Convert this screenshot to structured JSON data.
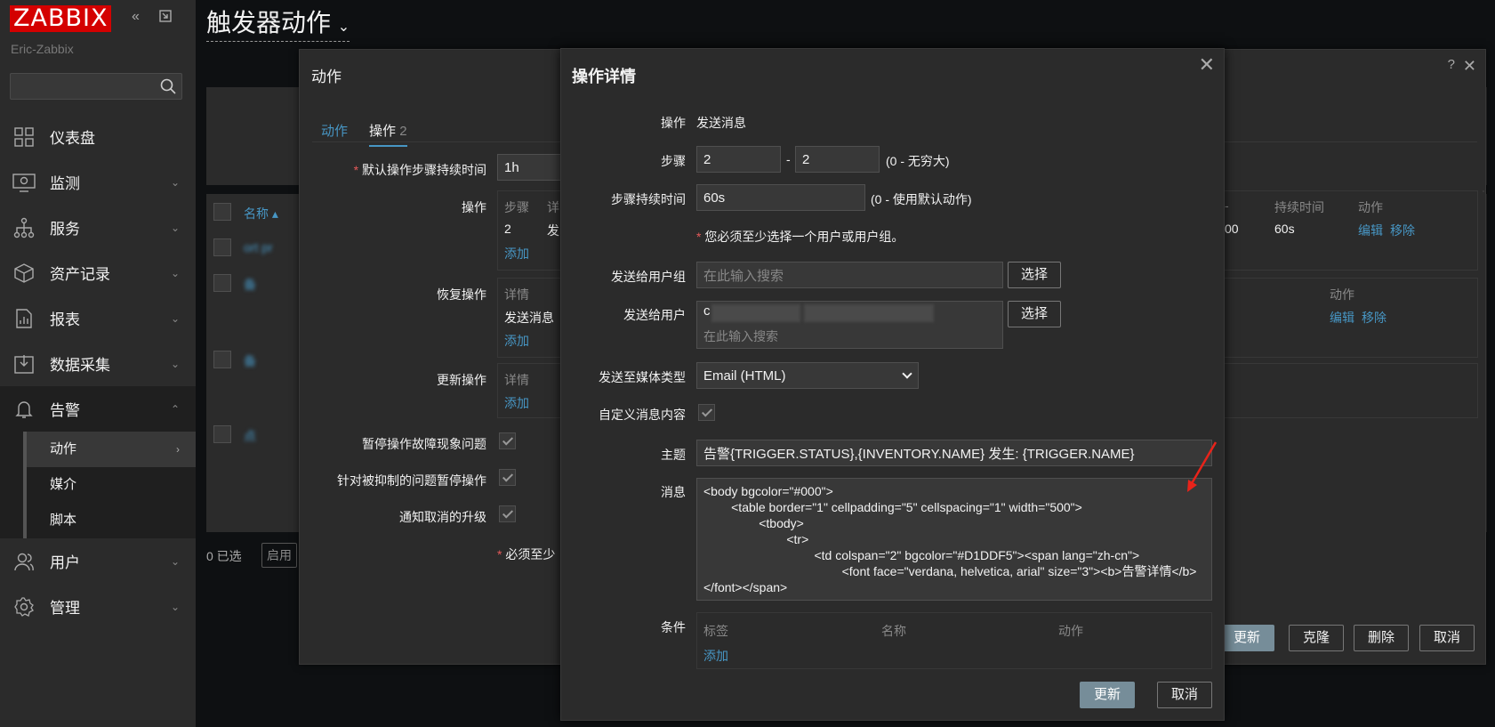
{
  "app": {
    "logo": "ZABBIX",
    "server_name": "Eric-Zabbix",
    "page_title": "触发器动作"
  },
  "sidebar": {
    "items": [
      {
        "label": "仪表盘",
        "icon": "dashboard-icon"
      },
      {
        "label": "监测",
        "icon": "monitoring-icon"
      },
      {
        "label": "服务",
        "icon": "services-icon"
      },
      {
        "label": "资产记录",
        "icon": "inventory-icon"
      },
      {
        "label": "报表",
        "icon": "reports-icon"
      },
      {
        "label": "数据采集",
        "icon": "data-collection-icon"
      },
      {
        "label": "告警",
        "icon": "alerts-icon"
      },
      {
        "label": "用户",
        "icon": "users-icon"
      },
      {
        "label": "管理",
        "icon": "administration-icon"
      }
    ],
    "sub_items": [
      {
        "label": "动作"
      },
      {
        "label": "媒介"
      },
      {
        "label": "脚本"
      }
    ]
  },
  "background": {
    "name_col": "名称 ▴",
    "row1": "ort pr",
    "row2": "备",
    "row3": "备",
    "row4": "点",
    "selected": "0 已选",
    "enable_btn": "启用",
    "duration_head": "持续时间",
    "action_head": "动作",
    "action_head2": "动作",
    "col_end": "00",
    "dur_val": "60s",
    "edit": "编辑",
    "remove": "移除",
    "edit2": "编辑",
    "remove2": "移除",
    "num_head": "-"
  },
  "action_dialog": {
    "title": "动作",
    "help": "?",
    "close": "✕",
    "tabs": [
      {
        "label": "动作"
      },
      {
        "label": "操作",
        "count": "2"
      }
    ],
    "default_duration_label": "默认操作步骤持续时间",
    "default_duration_value": "1h",
    "ops_label": "操作",
    "ops_head_steps": "步骤",
    "ops_head_details": "详",
    "ops_step_val": "2",
    "ops_detail_val": "发",
    "add": "添加",
    "recovery_label": "恢复操作",
    "recovery_head": "详情",
    "recovery_val": "发送消息",
    "update_ops_label": "更新操作",
    "update_head": "详情",
    "pause_symptoms_label": "暂停操作故障现象问题",
    "pause_suppressed_label": "针对被抑制的问题暂停操作",
    "notify_cancel_label": "通知取消的升级",
    "required_note": "必须至少",
    "buttons": {
      "update": "更新",
      "clone": "克隆",
      "delete": "删除",
      "cancel": "取消"
    }
  },
  "op_dialog": {
    "title": "操作详情",
    "close": "✕",
    "operation_label": "操作",
    "operation_value": "发送消息",
    "steps_label": "步骤",
    "step_from": "2",
    "step_sep": "-",
    "step_to": "2",
    "step_hint": "(0 - 无穷大)",
    "step_duration_label": "步骤持续时间",
    "step_duration_value": "60s",
    "step_duration_hint": "(0 - 使用默认动作)",
    "required_msg": "您必须至少选择一个用户或用户组。",
    "user_groups_label": "发送给用户组",
    "user_groups_placeholder": "在此输入搜索",
    "select_btn": "选择",
    "users_label": "发送给用户",
    "users_chip": "c",
    "users_placeholder": "在此输入搜索",
    "select_btn2": "选择",
    "media_type_label": "发送至媒体类型",
    "media_type_value": "Email (HTML)",
    "custom_msg_label": "自定义消息内容",
    "subject_label": "主题",
    "subject_value": "告警{TRIGGER.STATUS},{INVENTORY.NAME} 发生: {TRIGGER.NAME}",
    "message_label": "消息",
    "message_value": "<body bgcolor=\"#000\">\n        <table border=\"1\" cellpadding=\"5\" cellspacing=\"1\" width=\"500\">\n                <tbody>\n                        <tr>\n                                <td colspan=\"2\" bgcolor=\"#D1DDF5\"><span lang=\"zh-cn\">\n                                        <font face=\"verdana, helvetica, arial\" size=\"3\"><b>告警详情</b></font></span>",
    "conditions_label": "条件",
    "cond_head_label": "标签",
    "cond_head_name": "名称",
    "cond_head_action": "动作",
    "add": "添加",
    "update_btn": "更新",
    "cancel_btn": "取消"
  },
  "colors": {
    "accent": "#4796c4",
    "logo_red": "#d40000",
    "arrow_red": "#e8231a",
    "panel": "#2b2b2b"
  }
}
